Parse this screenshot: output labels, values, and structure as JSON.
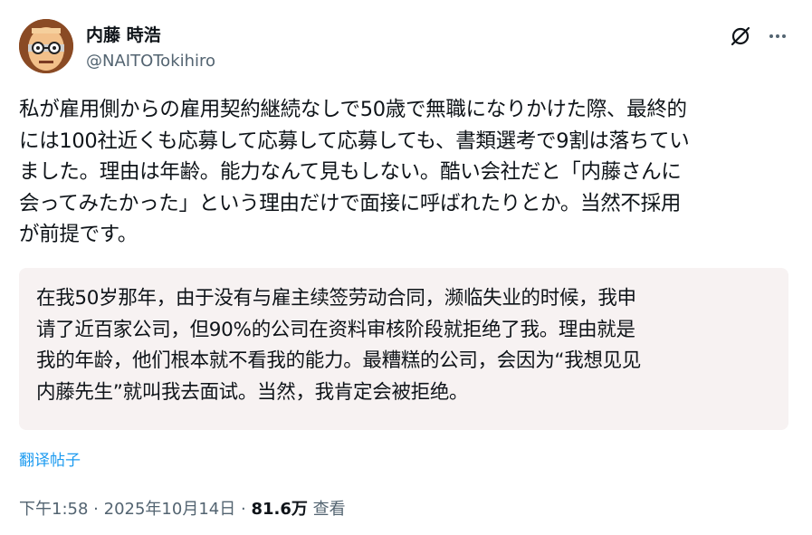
{
  "author": {
    "display_name": "内藤 時浩",
    "handle": "@NAITOTokihiro"
  },
  "post": {
    "lines": [
      "私が雇用側からの雇用契約継続なしで50歳で無職になりかけた際、最終的",
      "には100社近くも応募して応募して応募しても、書類選考で9割は落ちてい",
      "ました。理由は年齢。能力なんて見もしない。酷い会社だと「内藤さんに",
      "会ってみたかった」という理由だけで面接に呼ばれたりとか。当然不採用",
      "が前提です。"
    ]
  },
  "translation": {
    "lines": [
      "在我50岁那年，由于没有与雇主续签劳动合同，濒临失业的时候，我申",
      "请了近百家公司，但90%的公司在资料审核阶段就拒绝了我。理由就是",
      "我的年龄，他们根本就不看我的能力。最糟糕的公司，会因为“我想见见",
      "内藤先生”就叫我去面试。当然，我肯定会被拒绝。"
    ],
    "link_label": "翻译帖子"
  },
  "meta": {
    "time": "下午1:58",
    "separator": "·",
    "date": "2025年10月14日",
    "views_count": "81.6万",
    "views_label": "查看"
  },
  "icons": {
    "grok": "grok-icon",
    "more": "more-icon"
  },
  "colors": {
    "text": "#0f1419",
    "secondary": "#536471",
    "link": "#1d9bf0",
    "translation_bg": "#f7f2f2"
  }
}
